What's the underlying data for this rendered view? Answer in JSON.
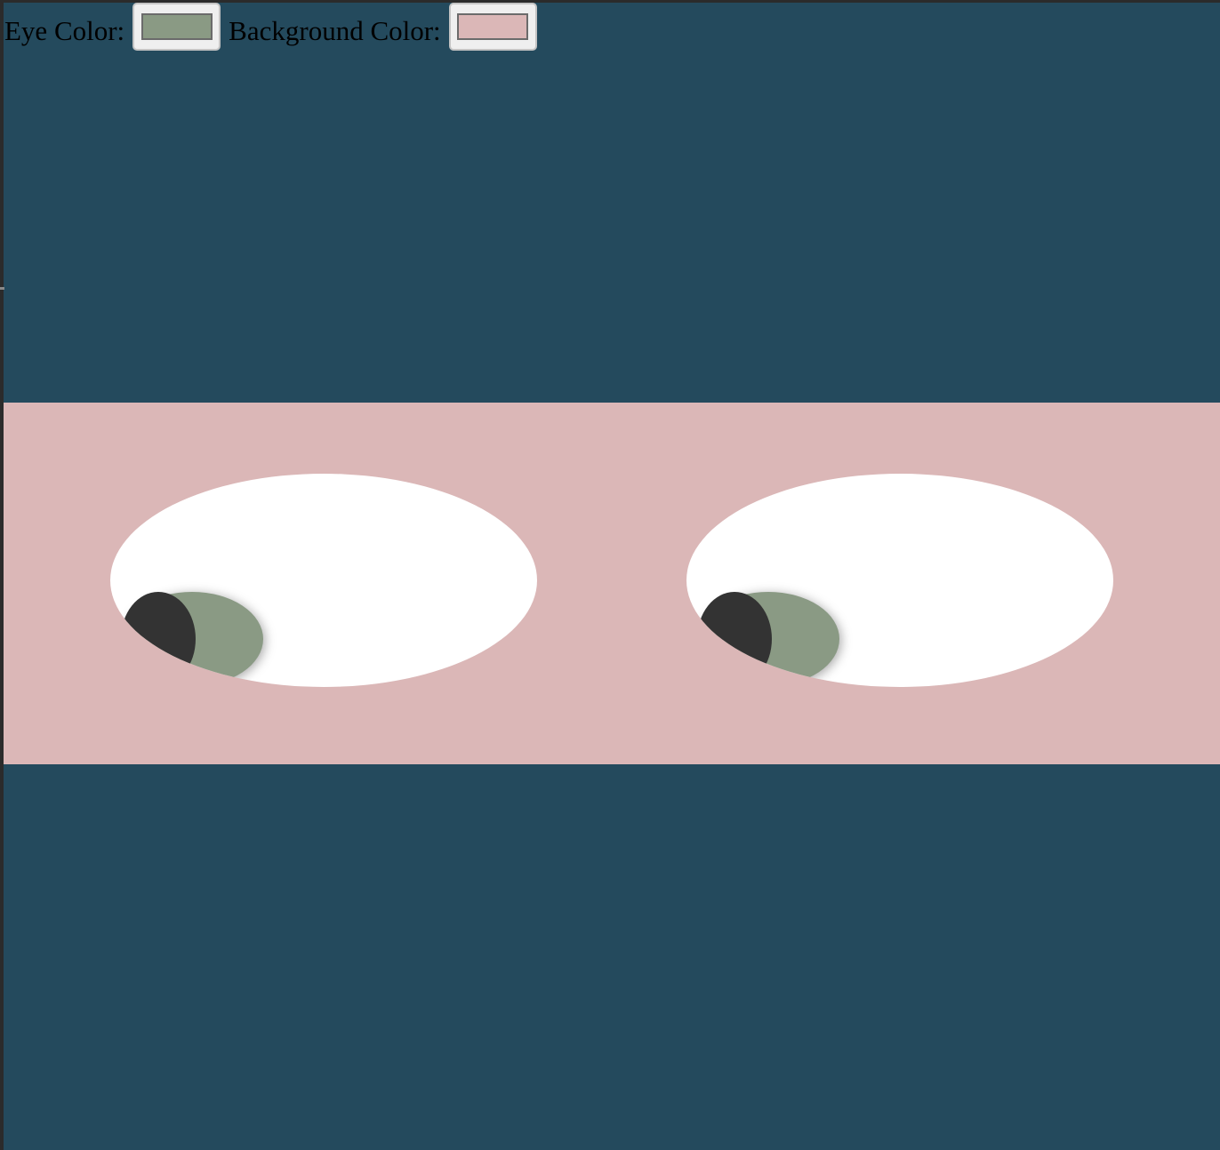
{
  "controls": {
    "eye_color_label": "Eye Color:",
    "eye_color_value": "#8a9a84",
    "background_color_label": "Background Color:",
    "background_color_value": "#dbb7b7"
  },
  "colors": {
    "page_background": "#244a5d",
    "sclera": "#ffffff",
    "pupil": "#333333"
  }
}
